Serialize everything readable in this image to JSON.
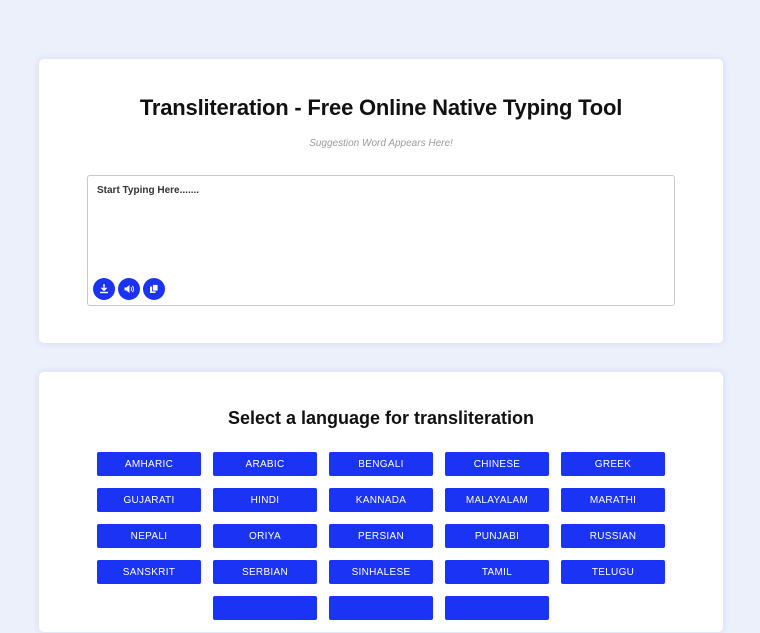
{
  "header": {
    "title": "Transliteration - Free Online Native Typing Tool",
    "suggestion": "Suggestion Word Appears Here!"
  },
  "editor": {
    "placeholder": "Start Typing Here.......",
    "tools": [
      {
        "icon": "download-icon"
      },
      {
        "icon": "speaker-icon"
      },
      {
        "icon": "copy-icon"
      }
    ]
  },
  "languages": {
    "title": "Select a language for transliteration",
    "items": [
      "AMHARIC",
      "ARABIC",
      "BENGALI",
      "CHINESE",
      "GREEK",
      "GUJARATI",
      "HINDI",
      "KANNADA",
      "MALAYALAM",
      "MARATHI",
      "NEPALI",
      "ORIYA",
      "PERSIAN",
      "PUNJABI",
      "RUSSIAN",
      "SANSKRIT",
      "SERBIAN",
      "SINHALESE",
      "TAMIL",
      "TELUGU",
      "",
      "",
      ""
    ]
  },
  "colors": {
    "accent": "#1a33f5",
    "background": "#ecf0fb"
  }
}
